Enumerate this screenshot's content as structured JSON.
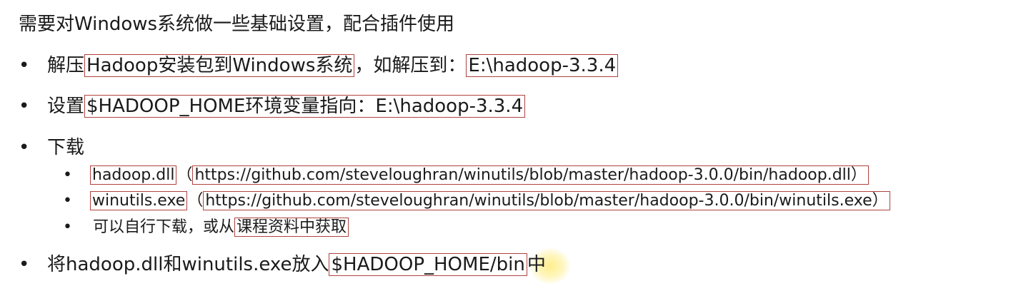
{
  "intro": "需要对Windows系统做一些基础设置，配合插件使用",
  "bullet_char": "•",
  "items": [
    {
      "prefix": "解压",
      "box1": "Hadoop安装包到Windows系统",
      "middle": "，如解压到：",
      "box2": "E:\\hadoop-3.3.4"
    },
    {
      "prefix": "设置",
      "box1": "$HADOOP_HOME环境变量指向：E:\\hadoop-3.3.4"
    },
    {
      "prefix": "下载"
    },
    {
      "prefix": "将hadoop.dll和winutils.exe放入",
      "box1": "$HADOOP_HOME/bin",
      "suffix": "中"
    }
  ],
  "sub_items": [
    {
      "box1": "hadoop.dll",
      "open": "（",
      "box2": "https://github.com/steveloughran/winutils/blob/master/hadoop-3.0.0/bin/hadoop.dll）"
    },
    {
      "box1": "winutils.exe",
      "open": "（",
      "box2": "https://github.com/steveloughran/winutils/blob/master/hadoop-3.0.0/bin/winutils.exe）"
    },
    {
      "prefix": "可以自行下载，或从",
      "box1": "课程资料中获取"
    }
  ]
}
